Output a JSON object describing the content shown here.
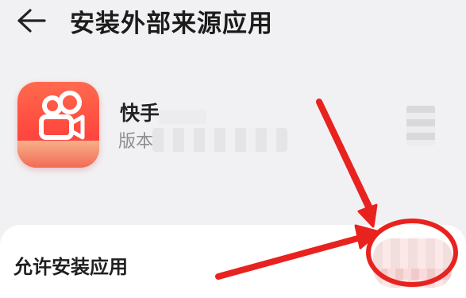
{
  "header": {
    "back_icon": "arrow-left-icon",
    "title": "安装外部来源应用"
  },
  "app": {
    "icon": "kuaishou-app-icon",
    "name": "快手",
    "version_prefix": "版本"
  },
  "setting": {
    "label": "允许安装应用"
  },
  "colors": {
    "annotation_red": "#e8231f",
    "app_icon_red": "#ff4a3f",
    "background": "#f1f1f3",
    "card": "#ffffff"
  }
}
